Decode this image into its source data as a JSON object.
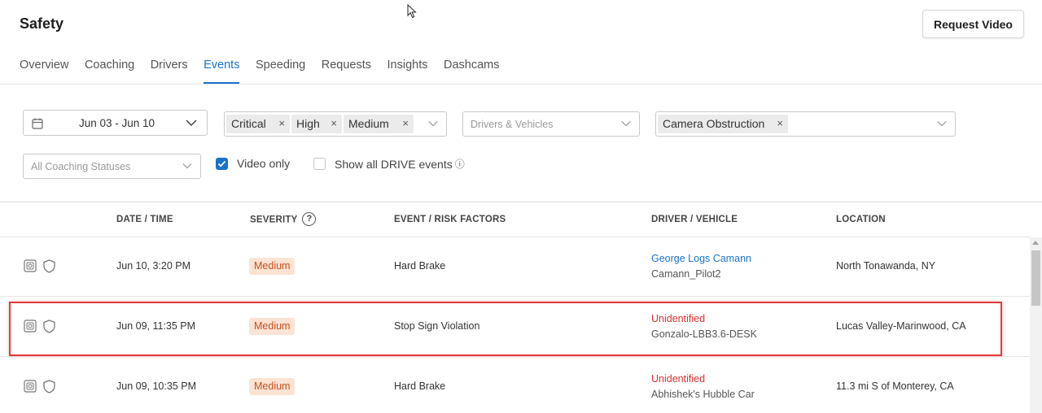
{
  "header": {
    "title": "Safety",
    "request_video_label": "Request Video"
  },
  "tabs": [
    {
      "label": "Overview",
      "active": false
    },
    {
      "label": "Coaching",
      "active": false
    },
    {
      "label": "Drivers",
      "active": false
    },
    {
      "label": "Events",
      "active": true
    },
    {
      "label": "Speeding",
      "active": false
    },
    {
      "label": "Requests",
      "active": false
    },
    {
      "label": "Insights",
      "active": false
    },
    {
      "label": "Dashcams",
      "active": false
    }
  ],
  "filters": {
    "date_range": "Jun 03 - Jun 10",
    "severity_chips": [
      "Critical",
      "High",
      "Medium"
    ],
    "drivers_vehicles_placeholder": "Drivers & Vehicles",
    "event_type_chips": [
      "Camera Obstruction"
    ],
    "coaching_status_placeholder": "All Coaching Statuses",
    "video_only": {
      "label": "Video only",
      "checked": true
    },
    "show_all_drive": {
      "label": "Show all DRIVE events",
      "checked": false
    },
    "chip_remove_glyph": "×",
    "info_glyph": "ⓘ"
  },
  "table": {
    "columns": [
      "DATE / TIME",
      "SEVERITY",
      "EVENT / RISK FACTORS",
      "DRIVER / VEHICLE",
      "LOCATION"
    ],
    "severity_help_glyph": "?",
    "rows": [
      {
        "date": "Jun 10, 3:20 PM",
        "severity": "Medium",
        "event": "Hard Brake",
        "driver": "George Logs Camann",
        "driver_identified": true,
        "vehicle": "Camann_Pilot2",
        "location": "North Tonawanda, NY"
      },
      {
        "date": "Jun 09, 11:35 PM",
        "severity": "Medium",
        "event": "Stop Sign Violation",
        "driver": "Unidentified",
        "driver_identified": false,
        "vehicle": "Gonzalo-LBB3.6-DESK",
        "location": "Lucas Valley-Marinwood, CA"
      },
      {
        "date": "Jun 09, 10:35 PM",
        "severity": "Medium",
        "event": "Hard Brake",
        "driver": "Unidentified",
        "driver_identified": false,
        "vehicle": "Abhishek's Hubble Car",
        "location": "11.3 mi S of Monterey, CA"
      }
    ]
  },
  "colors": {
    "accent": "#1a73c8",
    "severity_badge_bg": "#fde3d3",
    "severity_badge_text": "#c2501c",
    "unidentified": "#d6322f",
    "highlight": "#e23b3b"
  },
  "icons": [
    "calendar-icon",
    "chevron-down-icon",
    "close-icon",
    "check-icon",
    "info-icon",
    "help-icon",
    "camera-icon",
    "shield-icon",
    "mouse-cursor-icon"
  ]
}
